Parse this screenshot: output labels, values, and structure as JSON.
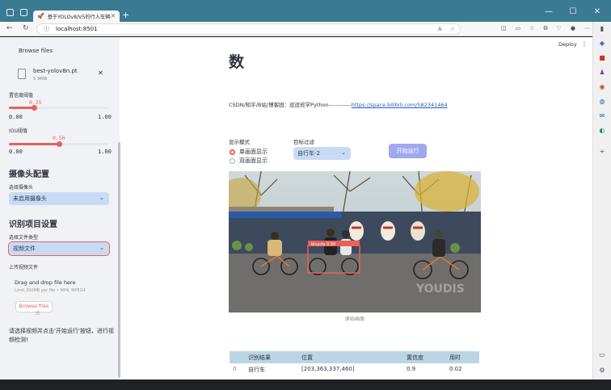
{
  "browser": {
    "tab_title": "基于YOLOv8/V5的行人车辆检测",
    "new_tab": "+",
    "url": "localhost:8501",
    "window_controls": [
      "—",
      "☐",
      "✕"
    ]
  },
  "sidebar": {
    "browse_files_top": "Browse files",
    "file_name": "best-yolov8n.pt",
    "file_size": "5.9MB",
    "close": "✕",
    "conf_label": "置信度阈值",
    "conf": {
      "value": "0.25",
      "min": "0.00",
      "max": "1.00",
      "fraction": 0.25
    },
    "iou_label": "IOU阈值",
    "iou": {
      "value": "0.50",
      "min": "0.00",
      "max": "1.00",
      "fraction": 0.5
    },
    "camera_header": "摄像头配置",
    "camera_label": "选择摄像头",
    "camera_value": "未启用摄像头",
    "detect_header": "识别项目设置",
    "file_type_label": "选择文件类型",
    "file_type_value": "视频文件",
    "upload_label": "上传视频文件",
    "drop_text": "Drag and drop file here",
    "drop_limit": "Limit 200MB per file • MP4, MPEG4",
    "browse_button": "Browse files",
    "hint": "请选择视频并点击'开始运行'按钮，进行视频检测!"
  },
  "main": {
    "deploy": "Deploy",
    "menu": "⋮",
    "title": "数",
    "credit_prefix": "CSDN/知乎/B站/博客园：逗逗班学Python------------",
    "credit_link": "https://space.bilibili.com/582341464",
    "display_mode_label": "显示模式",
    "mode_single": "单画面显示",
    "mode_dual": "双画面显示",
    "target_label": "目标过滤",
    "target_value": "自行车-2",
    "run_button": "开始运行",
    "caption": "原始画面",
    "detection_label": "bicycle 0.90",
    "watermark": "YOUDIS"
  },
  "table": {
    "headers": [
      "",
      "识别结果",
      "位置",
      "置信度",
      "用时"
    ],
    "rows": [
      [
        "0",
        "自行车",
        "[203,363,337,460]",
        "0.9",
        "0.02"
      ]
    ]
  },
  "colors": {
    "accent": "#e8615b",
    "sidebar_bg": "#f0f2f6",
    "select_bg": "#c8dbf5",
    "button_disabled": "#9fa8f0",
    "title_bar": "#3a7a93",
    "table_head": "#bcd5e4"
  }
}
